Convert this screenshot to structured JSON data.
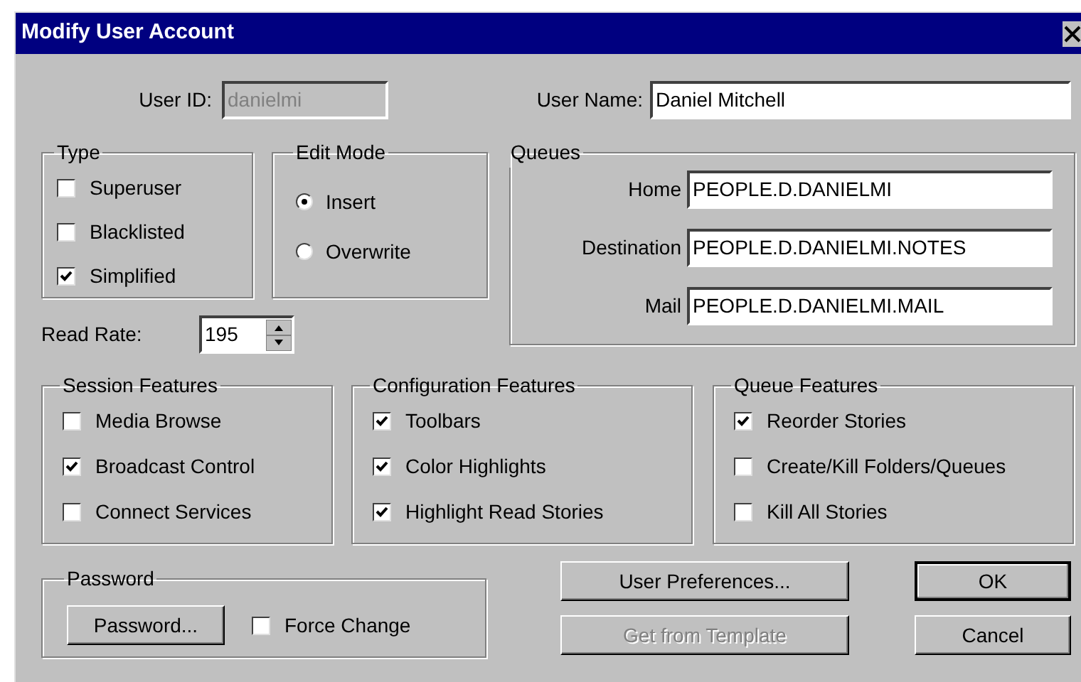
{
  "window": {
    "title": "Modify User Account"
  },
  "user_id": {
    "label": "User ID:",
    "value": "danielmi",
    "disabled": true
  },
  "user_name": {
    "label": "User Name:",
    "value": "Daniel Mitchell"
  },
  "type": {
    "title": "Type",
    "options": [
      {
        "label": "Superuser",
        "checked": false
      },
      {
        "label": "Blacklisted",
        "checked": false
      },
      {
        "label": "Simplified",
        "checked": true
      }
    ]
  },
  "edit_mode": {
    "title": "Edit Mode",
    "options": [
      {
        "label": "Insert",
        "selected": true
      },
      {
        "label": "Overwrite",
        "selected": false
      }
    ]
  },
  "queues": {
    "title": "Queues",
    "fields": [
      {
        "label": "Home",
        "value": "PEOPLE.D.DANIELMI"
      },
      {
        "label": "Destination",
        "value": "PEOPLE.D.DANIELMI.NOTES"
      },
      {
        "label": "Mail",
        "value": "PEOPLE.D.DANIELMI.MAIL"
      }
    ]
  },
  "read_rate": {
    "label": "Read Rate:",
    "value": "195"
  },
  "feature_groups": [
    {
      "title": "Session Features",
      "options": [
        {
          "label": "Media Browse",
          "checked": false
        },
        {
          "label": "Broadcast Control",
          "checked": true
        },
        {
          "label": "Connect Services",
          "checked": false
        }
      ]
    },
    {
      "title": "Configuration Features",
      "options": [
        {
          "label": "Toolbars",
          "checked": true
        },
        {
          "label": "Color Highlights",
          "checked": true
        },
        {
          "label": "Highlight Read Stories",
          "checked": true
        }
      ]
    },
    {
      "title": "Queue Features",
      "options": [
        {
          "label": "Reorder Stories",
          "checked": true
        },
        {
          "label": "Create/Kill Folders/Queues",
          "checked": false
        },
        {
          "label": "Kill All Stories",
          "checked": false
        }
      ]
    }
  ],
  "password": {
    "title": "Password",
    "button": "Password...",
    "force_change": {
      "label": "Force Change",
      "checked": false
    }
  },
  "buttons": [
    {
      "label": "User Preferences...",
      "disabled": false,
      "default": false
    },
    {
      "label": "OK",
      "disabled": false,
      "default": true
    },
    {
      "label": "Get from Template",
      "disabled": true,
      "default": false
    },
    {
      "label": "Cancel",
      "disabled": false,
      "default": false
    }
  ]
}
